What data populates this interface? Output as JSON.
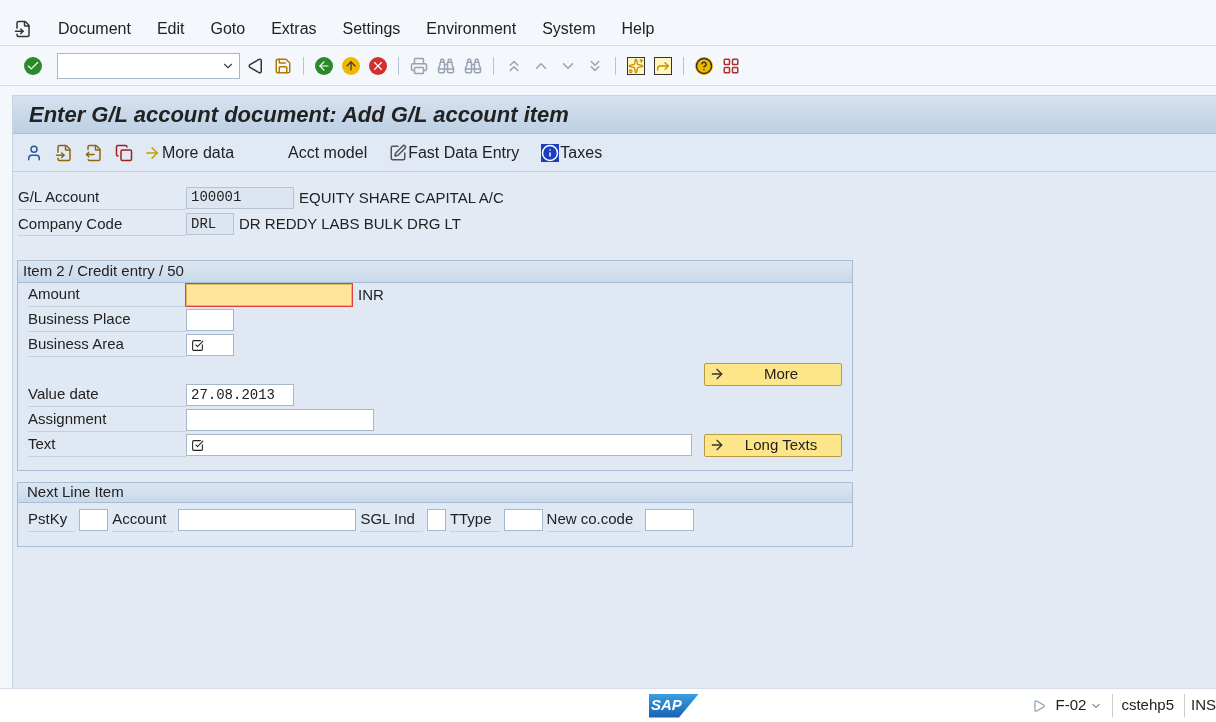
{
  "menu": [
    {
      "label": "Document"
    },
    {
      "label": "Edit"
    },
    {
      "label": "Goto"
    },
    {
      "label": "Extras"
    },
    {
      "label": "Settings"
    },
    {
      "label": "Environment"
    },
    {
      "label": "System"
    },
    {
      "label": "Help"
    }
  ],
  "title": "Enter G/L account document: Add G/L account item",
  "app_toolbar": [
    {
      "kind": "icon"
    },
    {
      "kind": "icon"
    },
    {
      "kind": "icon"
    },
    {
      "kind": "icon"
    },
    {
      "kind": "text",
      "label": "More data"
    },
    {
      "kind": "text",
      "label": "Acct model"
    },
    {
      "kind": "text",
      "label": "Fast Data Entry"
    },
    {
      "kind": "text",
      "label": "Taxes"
    }
  ],
  "header_fields": [
    {
      "label": "G/L Account",
      "value": "100001",
      "description": "EQUITY SHARE CAPITAL A/C"
    },
    {
      "label": "Company Code",
      "value": "DRL",
      "description": "DR REDDY LABS BULK DRG LT"
    }
  ],
  "item_group": {
    "title": "Item 2 / Credit entry / 50",
    "rows": [
      {
        "kind": "field",
        "label": "Amount",
        "unit": "INR",
        "focused": true,
        "required": false
      },
      {
        "kind": "field",
        "label": "Business Place",
        "focused": false,
        "required": false
      },
      {
        "kind": "field",
        "label": "Business Area",
        "focused": false,
        "required": true
      },
      {
        "kind": "button",
        "button": "More"
      },
      {
        "kind": "field",
        "label": "Value date",
        "value": "27.08.2013",
        "focused": false,
        "required": false
      },
      {
        "kind": "field",
        "label": "Assignment",
        "focused": false,
        "required": false
      },
      {
        "kind": "field",
        "label": "Text",
        "focused": false,
        "required": true,
        "button": "Long Texts"
      }
    ]
  },
  "next_line_group": {
    "title": "Next Line Item",
    "fields": [
      {
        "label": "PstKy"
      },
      {
        "label": "Account"
      },
      {
        "label": "SGL Ind"
      },
      {
        "label": "TType"
      },
      {
        "label": "New co.code"
      }
    ]
  },
  "status_bar": {
    "logo": "SAP",
    "transaction": "F-02",
    "server": "cstehp5",
    "mode": "INS"
  }
}
